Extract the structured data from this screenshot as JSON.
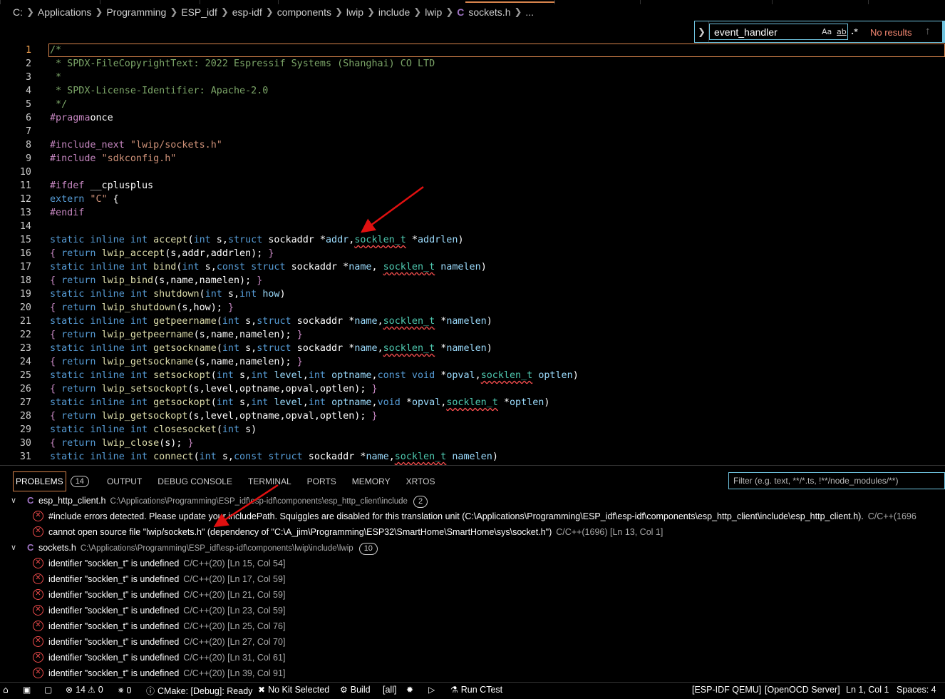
{
  "breadcrumb": {
    "items": [
      "C:",
      "Applications",
      "Programming",
      "ESP_idf",
      "esp-idf",
      "components",
      "lwip",
      "include",
      "lwip"
    ],
    "file": "sockets.h",
    "file_icon": "C",
    "ellipsis": "..."
  },
  "find": {
    "value": "event_handler",
    "match_case": "Aa",
    "whole_word": "ab",
    "regex": ".*",
    "status": "No results"
  },
  "editor": {
    "current_line": 1,
    "lines": [
      {
        "n": "1"
      },
      {
        "n": "2"
      },
      {
        "n": "3"
      },
      {
        "n": "4"
      },
      {
        "n": "5"
      },
      {
        "n": "6"
      },
      {
        "n": "7"
      },
      {
        "n": "8"
      },
      {
        "n": "9"
      },
      {
        "n": "10"
      },
      {
        "n": "11"
      },
      {
        "n": "12"
      },
      {
        "n": "13"
      },
      {
        "n": "14"
      },
      {
        "n": "15"
      },
      {
        "n": "16"
      },
      {
        "n": "17"
      },
      {
        "n": "18"
      },
      {
        "n": "19"
      },
      {
        "n": "20"
      },
      {
        "n": "21"
      },
      {
        "n": "22"
      },
      {
        "n": "23"
      },
      {
        "n": "24"
      },
      {
        "n": "25"
      },
      {
        "n": "26"
      },
      {
        "n": "27"
      },
      {
        "n": "28"
      },
      {
        "n": "29"
      },
      {
        "n": "30"
      },
      {
        "n": "31"
      }
    ],
    "code": [
      [
        [
          "cm",
          "/*"
        ]
      ],
      [
        [
          "cm",
          " * SPDX-FileCopyrightText: 2022 Espressif Systems (Shanghai) CO LTD"
        ]
      ],
      [
        [
          "cm",
          " *"
        ]
      ],
      [
        [
          "cm",
          " * SPDX-License-Identifier: Apache-2.0"
        ]
      ],
      [
        [
          "cm",
          " */"
        ]
      ],
      [
        [
          "pp",
          "#pragma"
        ],
        [
          "",
          "once"
        ]
      ],
      [],
      [
        [
          "pp",
          "#include_next"
        ],
        [
          "st",
          " \"lwip/sockets.h\""
        ]
      ],
      [
        [
          "pp",
          "#include"
        ],
        [
          "st",
          " \"sdkconfig.h\""
        ]
      ],
      [],
      [
        [
          "pp",
          "#ifdef"
        ],
        [
          "",
          " __cplusplus"
        ]
      ],
      [
        [
          "kw",
          "extern"
        ],
        [
          "st",
          " \"C\""
        ],
        [
          "",
          " {"
        ]
      ],
      [
        [
          "pp",
          "#endif"
        ]
      ],
      [],
      [
        [
          "kw",
          "static inline int "
        ],
        [
          "fn",
          "accept"
        ],
        [
          "",
          "("
        ],
        [
          "kw",
          "int"
        ],
        [
          "",
          " s,"
        ],
        [
          "kw",
          "struct"
        ],
        [
          "",
          " sockaddr *"
        ],
        [
          "pm",
          "addr"
        ],
        [
          ",",
          ""
        ],
        [
          "err",
          "socklen_t"
        ],
        [
          "",
          " *"
        ],
        [
          "pm",
          "addrlen"
        ],
        [
          "",
          ")"
        ]
      ],
      [
        [
          "pp",
          "{"
        ],
        [
          "",
          " "
        ],
        [
          "kw",
          "return"
        ],
        [
          "",
          " "
        ],
        [
          "fn",
          "lwip_accept"
        ],
        [
          "",
          "(s,addr,addrlen); "
        ],
        [
          "pp",
          "}"
        ]
      ],
      [
        [
          "kw",
          "static inline int "
        ],
        [
          "fn",
          "bind"
        ],
        [
          "",
          "("
        ],
        [
          "kw",
          "int"
        ],
        [
          "",
          " s,"
        ],
        [
          "kw",
          "const struct"
        ],
        [
          "",
          " sockaddr *"
        ],
        [
          "pm",
          "name"
        ],
        [
          "",
          ", "
        ],
        [
          "err",
          "socklen_t"
        ],
        [
          "",
          " "
        ],
        [
          "pm",
          "namelen"
        ],
        [
          "",
          ")"
        ]
      ],
      [
        [
          "pp",
          "{"
        ],
        [
          "",
          " "
        ],
        [
          "kw",
          "return"
        ],
        [
          "",
          " "
        ],
        [
          "fn",
          "lwip_bind"
        ],
        [
          "",
          "(s,name,namelen); "
        ],
        [
          "pp",
          "}"
        ]
      ],
      [
        [
          "kw",
          "static inline int "
        ],
        [
          "fn",
          "shutdown"
        ],
        [
          "",
          "("
        ],
        [
          "kw",
          "int"
        ],
        [
          "",
          " s,"
        ],
        [
          "kw",
          "int"
        ],
        [
          "",
          " "
        ],
        [
          "pm",
          "how"
        ],
        [
          "",
          ")"
        ]
      ],
      [
        [
          "pp",
          "{"
        ],
        [
          "",
          " "
        ],
        [
          "kw",
          "return"
        ],
        [
          "",
          " "
        ],
        [
          "fn",
          "lwip_shutdown"
        ],
        [
          "",
          "(s,how); "
        ],
        [
          "pp",
          "}"
        ]
      ],
      [
        [
          "kw",
          "static inline int "
        ],
        [
          "fn",
          "getpeername"
        ],
        [
          "",
          "("
        ],
        [
          "kw",
          "int"
        ],
        [
          "",
          " s,"
        ],
        [
          "kw",
          "struct"
        ],
        [
          "",
          " sockaddr *"
        ],
        [
          "pm",
          "name"
        ],
        [
          ",",
          ""
        ],
        [
          "err",
          "socklen_t"
        ],
        [
          "",
          " *"
        ],
        [
          "pm",
          "namelen"
        ],
        [
          "",
          ")"
        ]
      ],
      [
        [
          "pp",
          "{"
        ],
        [
          "",
          " "
        ],
        [
          "kw",
          "return"
        ],
        [
          "",
          " "
        ],
        [
          "fn",
          "lwip_getpeername"
        ],
        [
          "",
          "(s,name,namelen); "
        ],
        [
          "pp",
          "}"
        ]
      ],
      [
        [
          "kw",
          "static inline int "
        ],
        [
          "fn",
          "getsockname"
        ],
        [
          "",
          "("
        ],
        [
          "kw",
          "int"
        ],
        [
          "",
          " s,"
        ],
        [
          "kw",
          "struct"
        ],
        [
          "",
          " sockaddr *"
        ],
        [
          "pm",
          "name"
        ],
        [
          ",",
          ""
        ],
        [
          "err",
          "socklen_t"
        ],
        [
          "",
          " *"
        ],
        [
          "pm",
          "namelen"
        ],
        [
          "",
          ")"
        ]
      ],
      [
        [
          "pp",
          "{"
        ],
        [
          "",
          " "
        ],
        [
          "kw",
          "return"
        ],
        [
          "",
          " "
        ],
        [
          "fn",
          "lwip_getsockname"
        ],
        [
          "",
          "(s,name,namelen); "
        ],
        [
          "pp",
          "}"
        ]
      ],
      [
        [
          "kw",
          "static inline int "
        ],
        [
          "fn",
          "setsockopt"
        ],
        [
          "",
          "("
        ],
        [
          "kw",
          "int"
        ],
        [
          "",
          " s,"
        ],
        [
          "kw",
          "int"
        ],
        [
          "",
          " "
        ],
        [
          "pm",
          "level"
        ],
        [
          ",",
          ""
        ],
        [
          "kw",
          "int"
        ],
        [
          "",
          " "
        ],
        [
          "pm",
          "optname"
        ],
        [
          ",",
          ""
        ],
        [
          "kw",
          "const void"
        ],
        [
          "",
          " *"
        ],
        [
          "pm",
          "opval"
        ],
        [
          ",",
          ""
        ],
        [
          "err",
          "socklen_t"
        ],
        [
          "",
          " "
        ],
        [
          "pm",
          "optlen"
        ],
        [
          "",
          ")"
        ]
      ],
      [
        [
          "pp",
          "{"
        ],
        [
          "",
          " "
        ],
        [
          "kw",
          "return"
        ],
        [
          "",
          " "
        ],
        [
          "fn",
          "lwip_setsockopt"
        ],
        [
          "",
          "(s,level,optname,opval,optlen); "
        ],
        [
          "pp",
          "}"
        ]
      ],
      [
        [
          "kw",
          "static inline int "
        ],
        [
          "fn",
          "getsockopt"
        ],
        [
          "",
          "("
        ],
        [
          "kw",
          "int"
        ],
        [
          "",
          " s,"
        ],
        [
          "kw",
          "int"
        ],
        [
          "",
          " "
        ],
        [
          "pm",
          "level"
        ],
        [
          ",",
          ""
        ],
        [
          "kw",
          "int"
        ],
        [
          "",
          " "
        ],
        [
          "pm",
          "optname"
        ],
        [
          ",",
          ""
        ],
        [
          "kw",
          "void"
        ],
        [
          "",
          " *"
        ],
        [
          "pm",
          "opval"
        ],
        [
          ",",
          ""
        ],
        [
          "err",
          "socklen_t"
        ],
        [
          "",
          " *"
        ],
        [
          "pm",
          "optlen"
        ],
        [
          "",
          ")"
        ]
      ],
      [
        [
          "pp",
          "{"
        ],
        [
          "",
          " "
        ],
        [
          "kw",
          "return"
        ],
        [
          "",
          " "
        ],
        [
          "fn",
          "lwip_getsockopt"
        ],
        [
          "",
          "(s,level,optname,opval,optlen); "
        ],
        [
          "pp",
          "}"
        ]
      ],
      [
        [
          "kw",
          "static inline int "
        ],
        [
          "fn",
          "closesocket"
        ],
        [
          "",
          "("
        ],
        [
          "kw",
          "int"
        ],
        [
          "",
          " s)"
        ]
      ],
      [
        [
          "pp",
          "{"
        ],
        [
          "",
          " "
        ],
        [
          "kw",
          "return"
        ],
        [
          "",
          " "
        ],
        [
          "fn",
          "lwip_close"
        ],
        [
          "",
          "(s); "
        ],
        [
          "pp",
          "}"
        ]
      ],
      [
        [
          "kw",
          "static inline int "
        ],
        [
          "fn",
          "connect"
        ],
        [
          "",
          "("
        ],
        [
          "kw",
          "int"
        ],
        [
          "",
          " s,"
        ],
        [
          "kw",
          "const struct"
        ],
        [
          "",
          " sockaddr *"
        ],
        [
          "pm",
          "name"
        ],
        [
          ",",
          ""
        ],
        [
          "err",
          "socklen_t"
        ],
        [
          "",
          " "
        ],
        [
          "pm",
          "namelen"
        ],
        [
          "",
          ")"
        ]
      ]
    ]
  },
  "panel": {
    "tabs": [
      {
        "label": "PROBLEMS",
        "badge": "14"
      },
      {
        "label": "OUTPUT"
      },
      {
        "label": "DEBUG CONSOLE"
      },
      {
        "label": "TERMINAL"
      },
      {
        "label": "PORTS"
      },
      {
        "label": "MEMORY"
      },
      {
        "label": "XRTOS"
      }
    ],
    "filter_placeholder": "Filter (e.g. text, **/*.ts, !**/node_modules/**)",
    "groups": [
      {
        "file": "esp_http_client.h",
        "path": "C:\\Applications\\Programming\\ESP_idf\\esp-idf\\components\\esp_http_client\\include",
        "count": "2",
        "items": [
          {
            "msg": "#include errors detected. Please update your includePath. Squiggles are disabled for this translation unit (C:\\Applications\\Programming\\ESP_idf\\esp-idf\\components\\esp_http_client\\include\\esp_http_client.h).",
            "src": "C/C++(1696"
          },
          {
            "msg": "cannot open source file \"lwip/sockets.h\" (dependency of \"C:\\A_jim\\Programming\\ESP32\\SmartHome\\SmartHome\\sys\\socket.h\")",
            "src": "C/C++(1696)  [Ln 13, Col 1]"
          }
        ]
      },
      {
        "file": "sockets.h",
        "path": "C:\\Applications\\Programming\\ESP_idf\\esp-idf\\components\\lwip\\include\\lwip",
        "count": "10",
        "items": [
          {
            "msg": "identifier \"socklen_t\" is undefined",
            "src": "C/C++(20)  [Ln 15, Col 54]"
          },
          {
            "msg": "identifier \"socklen_t\" is undefined",
            "src": "C/C++(20)  [Ln 17, Col 59]"
          },
          {
            "msg": "identifier \"socklen_t\" is undefined",
            "src": "C/C++(20)  [Ln 21, Col 59]"
          },
          {
            "msg": "identifier \"socklen_t\" is undefined",
            "src": "C/C++(20)  [Ln 23, Col 59]"
          },
          {
            "msg": "identifier \"socklen_t\" is undefined",
            "src": "C/C++(20)  [Ln 25, Col 76]"
          },
          {
            "msg": "identifier \"socklen_t\" is undefined",
            "src": "C/C++(20)  [Ln 27, Col 70]"
          },
          {
            "msg": "identifier \"socklen_t\" is undefined",
            "src": "C/C++(20)  [Ln 31, Col 61]"
          },
          {
            "msg": "identifier \"socklen_t\" is undefined",
            "src": "C/C++(20)  [Ln 39, Col 91]"
          }
        ]
      }
    ]
  },
  "status": {
    "errors": "14",
    "warnings": "0",
    "ports": "0",
    "cmake": "CMake: [Debug]: Ready",
    "kit": "No Kit Selected",
    "build": "Build",
    "target": "[all]",
    "run_ctest": "Run CTest",
    "qemu": "[ESP-IDF QEMU]",
    "openocd": "[OpenOCD Server]",
    "position": "Ln 1, Col 1",
    "spaces": "Spaces: 4"
  },
  "colors": {
    "accent": "#d7844c",
    "error": "#f14c4c",
    "focus": "#6fc3df"
  }
}
